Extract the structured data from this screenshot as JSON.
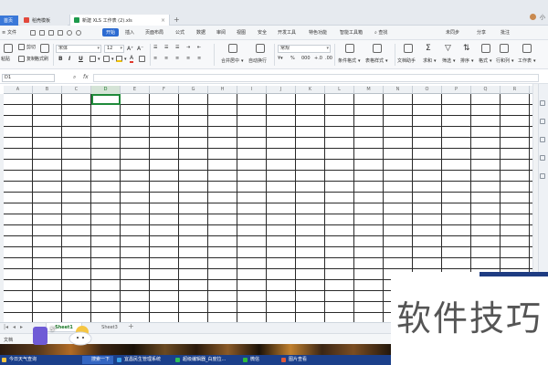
{
  "tabs": {
    "home": "首页",
    "template": "稻壳模板",
    "workbook": "新建 XLS 工作表 (2).xls",
    "add": "+"
  },
  "window": {
    "user": "小"
  },
  "menu": {
    "file": "文件",
    "items": [
      "开始",
      "插入",
      "页面布局",
      "公式",
      "数据",
      "审阅",
      "视图",
      "安全",
      "开发工具",
      "特色功能",
      "智能工具箱"
    ],
    "search": "查找",
    "right": [
      "未同步",
      "分享",
      "批注"
    ]
  },
  "ribbon": {
    "paste": "粘贴",
    "cut": "剪切",
    "copy": "复制",
    "format_painter": "格式刷",
    "font_name": "宋体",
    "font_size": "12",
    "bold": "B",
    "italic": "I",
    "underline": "U",
    "merge_center": "合并居中",
    "wrap_text": "自动换行",
    "number_format": "常规",
    "cond_format": "条件格式",
    "table_style": "表格样式",
    "doc_helper": "文档助手",
    "sum": "求和",
    "filter": "筛选",
    "sort": "排序",
    "format": "格式",
    "rows_cols": "行和列",
    "worksheet": "工作表"
  },
  "formula_bar": {
    "cell_ref": "D1",
    "fx": "fx",
    "value": ""
  },
  "grid": {
    "columns": [
      "A",
      "B",
      "C",
      "D",
      "E",
      "F",
      "G",
      "H",
      "I",
      "J",
      "K",
      "L",
      "M",
      "N",
      "O",
      "P",
      "Q",
      "R"
    ],
    "selected_column": "D",
    "selected_cell": "D1"
  },
  "sheets": {
    "active": "Sheet1",
    "other": "Sheet3",
    "add": "+"
  },
  "status": {
    "left": "文档"
  },
  "taskbar": {
    "weather": "今日天气查询",
    "items": [
      "搜索一下",
      "宜昌民生管理系统",
      "超级编辑器_白度拉...",
      "微信",
      "图片查看"
    ]
  },
  "weather_badge": {
    "temp": "5°"
  },
  "watermark": {
    "text": "软件技巧"
  },
  "colors": {
    "accent": "#2c6bd1",
    "selection": "#1f8a3a",
    "taskbar": "#1b3f8a"
  }
}
